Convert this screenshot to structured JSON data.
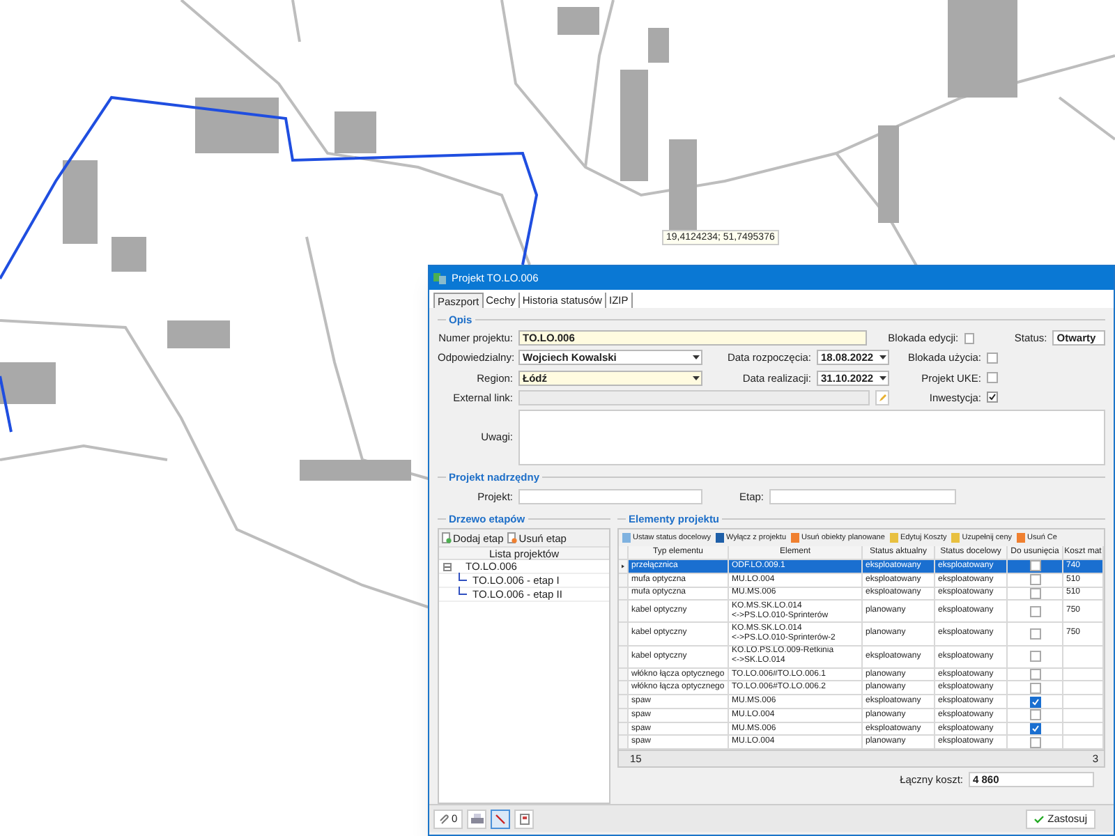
{
  "map": {
    "coordinates": "19,4124234; 51,7495376"
  },
  "window": {
    "title": "Projekt TO.LO.006"
  },
  "tabs": [
    {
      "label": "Paszport",
      "selected": true
    },
    {
      "label": "Cechy",
      "selected": false
    },
    {
      "label": "Historia statusów",
      "selected": false
    },
    {
      "label": "IZIP",
      "selected": false
    }
  ],
  "opis": {
    "title": "Opis",
    "numer_projektu": {
      "label": "Numer projektu:",
      "value": "TO.LO.006"
    },
    "odpowiedzialny": {
      "label": "Odpowiedzialny:",
      "value": "Wojciech Kowalski"
    },
    "region": {
      "label": "Region:",
      "value": "Łódź"
    },
    "external_link": {
      "label": "External link:"
    },
    "uwagi": {
      "label": "Uwagi:"
    },
    "data_rozpoczecia": {
      "label": "Data rozpoczęcia:",
      "value": "18.08.2022"
    },
    "data_realizacji": {
      "label": "Data realizacji:",
      "value": "31.10.2022"
    },
    "flags": [
      {
        "label": "Blokada edycji:",
        "checked": false
      },
      {
        "label": "Blokada użycia:",
        "checked": false
      },
      {
        "label": "Projekt UKE:",
        "checked": false
      },
      {
        "label": "Inwestycja:",
        "checked": true
      }
    ],
    "status": {
      "label": "Status:",
      "value": "Otwarty"
    }
  },
  "projekt_nadrzedny": {
    "title": "Projekt nadrzędny",
    "projekt_label": "Projekt:",
    "etap_label": "Etap:"
  },
  "drzewo": {
    "title": "Drzewo etapów",
    "buttons": [
      "Dodaj etap",
      "Usuń etap"
    ],
    "header": "Lista projektów",
    "tree": [
      {
        "label": "TO.LO.006",
        "expanded": true,
        "children": [
          {
            "label": "TO.LO.006 - etap I"
          },
          {
            "label": "TO.LO.006 - etap II"
          }
        ]
      }
    ]
  },
  "elementy": {
    "title": "Elementy projektu",
    "toolbar": [
      "Ustaw status docelowy",
      "Wyłącz z projektu",
      "Usuń obiekty planowane",
      "Edytuj Koszty",
      "Uzupełnij ceny",
      "Usuń Ce"
    ],
    "columns": [
      "Typ elementu",
      "Element",
      "Status aktualny",
      "Status docelowy",
      "Do usunięcia",
      "Koszt mat"
    ],
    "rows": [
      {
        "typ": "przełącznica",
        "element": "ODF.LO.009.1",
        "status_aktualny": "eksploatowany",
        "status_docelowy": "eksploatowany",
        "do_usuniecia": false,
        "koszt": "740",
        "selected": true
      },
      {
        "typ": "mufa optyczna",
        "element": "MU.LO.004",
        "status_aktualny": "eksploatowany",
        "status_docelowy": "eksploatowany",
        "do_usuniecia": false,
        "koszt": "510",
        "selected": false
      },
      {
        "typ": "mufa optyczna",
        "element": "MU.MS.006",
        "status_aktualny": "eksploatowany",
        "status_docelowy": "eksploatowany",
        "do_usuniecia": false,
        "koszt": "510",
        "selected": false
      },
      {
        "typ": "kabel optyczny",
        "element": "KO.MS.SK.LO.014\n<->PS.LO.010-Sprinterów",
        "status_aktualny": "planowany",
        "status_docelowy": "eksploatowany",
        "do_usuniecia": false,
        "koszt": "750",
        "selected": false
      },
      {
        "typ": "kabel optyczny",
        "element": "KO.MS.SK.LO.014\n<->PS.LO.010-Sprinterów-2",
        "status_aktualny": "planowany",
        "status_docelowy": "eksploatowany",
        "do_usuniecia": false,
        "koszt": "750",
        "selected": false
      },
      {
        "typ": "kabel optyczny",
        "element": "KO.LO.PS.LO.009-Retkinia\n<->SK.LO.014",
        "status_aktualny": "eksploatowany",
        "status_docelowy": "eksploatowany",
        "do_usuniecia": false,
        "selected": false
      },
      {
        "typ": "włókno łącza optycznego",
        "element": "TO.LO.006#TO.LO.006.1",
        "status_aktualny": "planowany",
        "status_docelowy": "eksploatowany",
        "do_usuniecia": false,
        "selected": false
      },
      {
        "typ": "włókno łącza optycznego",
        "element": "TO.LO.006#TO.LO.006.2",
        "status_aktualny": "planowany",
        "status_docelowy": "eksploatowany",
        "do_usuniecia": false,
        "selected": false
      },
      {
        "typ": "spaw",
        "element": "MU.MS.006",
        "status_aktualny": "eksploatowany",
        "status_docelowy": "eksploatowany",
        "do_usuniecia": true,
        "selected": false
      },
      {
        "typ": "spaw",
        "element": "MU.LO.004",
        "status_aktualny": "planowany",
        "status_docelowy": "eksploatowany",
        "do_usuniecia": false,
        "selected": false
      },
      {
        "typ": "spaw",
        "element": "MU.MS.006",
        "status_aktualny": "eksploatowany",
        "status_docelowy": "eksploatowany",
        "do_usuniecia": true,
        "selected": false
      },
      {
        "typ": "spaw",
        "element": "MU.LO.004",
        "status_aktualny": "planowany",
        "status_docelowy": "eksploatowany",
        "do_usuniecia": false,
        "selected": false
      }
    ],
    "footer_count": "15",
    "footer_sum": "3",
    "total": {
      "label": "Łączny koszt:",
      "value": "4 860"
    }
  },
  "bottom_toolbar": {
    "attachments": "0",
    "tool_selected": true,
    "apply": "Zastosuj"
  }
}
